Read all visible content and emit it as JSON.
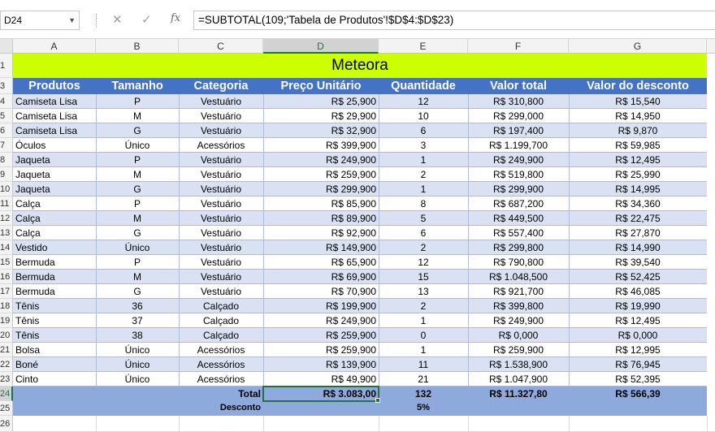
{
  "formula_bar": {
    "name_box": "D24",
    "cancel_icon": "✕",
    "enter_icon": "✓",
    "fx_icon": "fx",
    "formula": "=SUBTOTAL(109;'Tabela de Produtos'!$D$4:$D$23)"
  },
  "columns": [
    "A",
    "B",
    "C",
    "D",
    "E",
    "F",
    "G"
  ],
  "rows": [
    "1",
    "3",
    "4",
    "5",
    "6",
    "7",
    "8",
    "9",
    "10",
    "11",
    "12",
    "13",
    "14",
    "15",
    "16",
    "17",
    "18",
    "19",
    "20",
    "21",
    "22",
    "23",
    "24",
    "25",
    "26"
  ],
  "selected_cell": "D24",
  "title": "Meteora",
  "headers": [
    "Produtos",
    "Tamanho",
    "Categoria",
    "Preço Unitário",
    "Quantidade",
    "Valor total",
    "Valor do desconto"
  ],
  "data": [
    [
      "Camiseta Lisa",
      "P",
      "Vestuário",
      "R$ 25,900",
      "12",
      "R$ 310,800",
      "R$ 15,540"
    ],
    [
      "Camiseta Lisa",
      "M",
      "Vestuário",
      "R$ 29,900",
      "10",
      "R$ 299,000",
      "R$ 14,950"
    ],
    [
      "Camiseta Lisa",
      "G",
      "Vestuário",
      "R$ 32,900",
      "6",
      "R$ 197,400",
      "R$ 9,870"
    ],
    [
      "Óculos",
      "Único",
      "Acessórios",
      "R$ 399,900",
      "3",
      "R$ 1.199,700",
      "R$ 59,985"
    ],
    [
      "Jaqueta",
      "P",
      "Vestuário",
      "R$ 249,900",
      "1",
      "R$ 249,900",
      "R$ 12,495"
    ],
    [
      "Jaqueta",
      "M",
      "Vestuário",
      "R$ 259,900",
      "2",
      "R$ 519,800",
      "R$ 25,990"
    ],
    [
      "Jaqueta",
      "G",
      "Vestuário",
      "R$ 299,900",
      "1",
      "R$ 299,900",
      "R$ 14,995"
    ],
    [
      "Calça",
      "P",
      "Vestuário",
      "R$ 85,900",
      "8",
      "R$ 687,200",
      "R$ 34,360"
    ],
    [
      "Calça",
      "M",
      "Vestuário",
      "R$ 89,900",
      "5",
      "R$ 449,500",
      "R$ 22,475"
    ],
    [
      "Calça",
      "G",
      "Vestuário",
      "R$ 92,900",
      "6",
      "R$ 557,400",
      "R$ 27,870"
    ],
    [
      "Vestido",
      "Único",
      "Vestuário",
      "R$ 149,900",
      "2",
      "R$ 299,800",
      "R$ 14,990"
    ],
    [
      "Bermuda",
      "P",
      "Vestuário",
      "R$ 65,900",
      "12",
      "R$ 790,800",
      "R$ 39,540"
    ],
    [
      "Bermuda",
      "M",
      "Vestuário",
      "R$ 69,900",
      "15",
      "R$ 1.048,500",
      "R$ 52,425"
    ],
    [
      "Bermuda",
      "G",
      "Vestuário",
      "R$ 70,900",
      "13",
      "R$ 921,700",
      "R$ 46,085"
    ],
    [
      "Tênis",
      "36",
      "Calçado",
      "R$ 199,900",
      "2",
      "R$ 399,800",
      "R$ 19,990"
    ],
    [
      "Tênis",
      "37",
      "Calçado",
      "R$ 249,900",
      "1",
      "R$ 249,900",
      "R$ 12,495"
    ],
    [
      "Tênis",
      "38",
      "Calçado",
      "R$ 259,900",
      "0",
      "R$ 0,000",
      "R$ 0,000"
    ],
    [
      "Bolsa",
      "Único",
      "Acessórios",
      "R$ 259,900",
      "1",
      "R$ 259,900",
      "R$ 12,995"
    ],
    [
      "Boné",
      "Único",
      "Acessórios",
      "R$ 139,900",
      "11",
      "R$ 1.538,900",
      "R$ 76,945"
    ],
    [
      "Cinto",
      "Único",
      "Acessórios",
      "R$ 49,900",
      "21",
      "R$ 1.047,900",
      "R$ 52,395"
    ]
  ],
  "total": {
    "label": "Total",
    "preco": "R$ 3.083,00",
    "quantidade": "132",
    "valor_total": "R$ 11.327,80",
    "valor_desconto": "R$ 566,39"
  },
  "desconto": {
    "label": "Desconto",
    "value": "5%"
  },
  "colors": {
    "title_fill": "#ccff00",
    "header_fill": "#4472c4",
    "band_fill": "#d9e1f2",
    "total_fill": "#8ea9db",
    "selection": "#217346"
  }
}
